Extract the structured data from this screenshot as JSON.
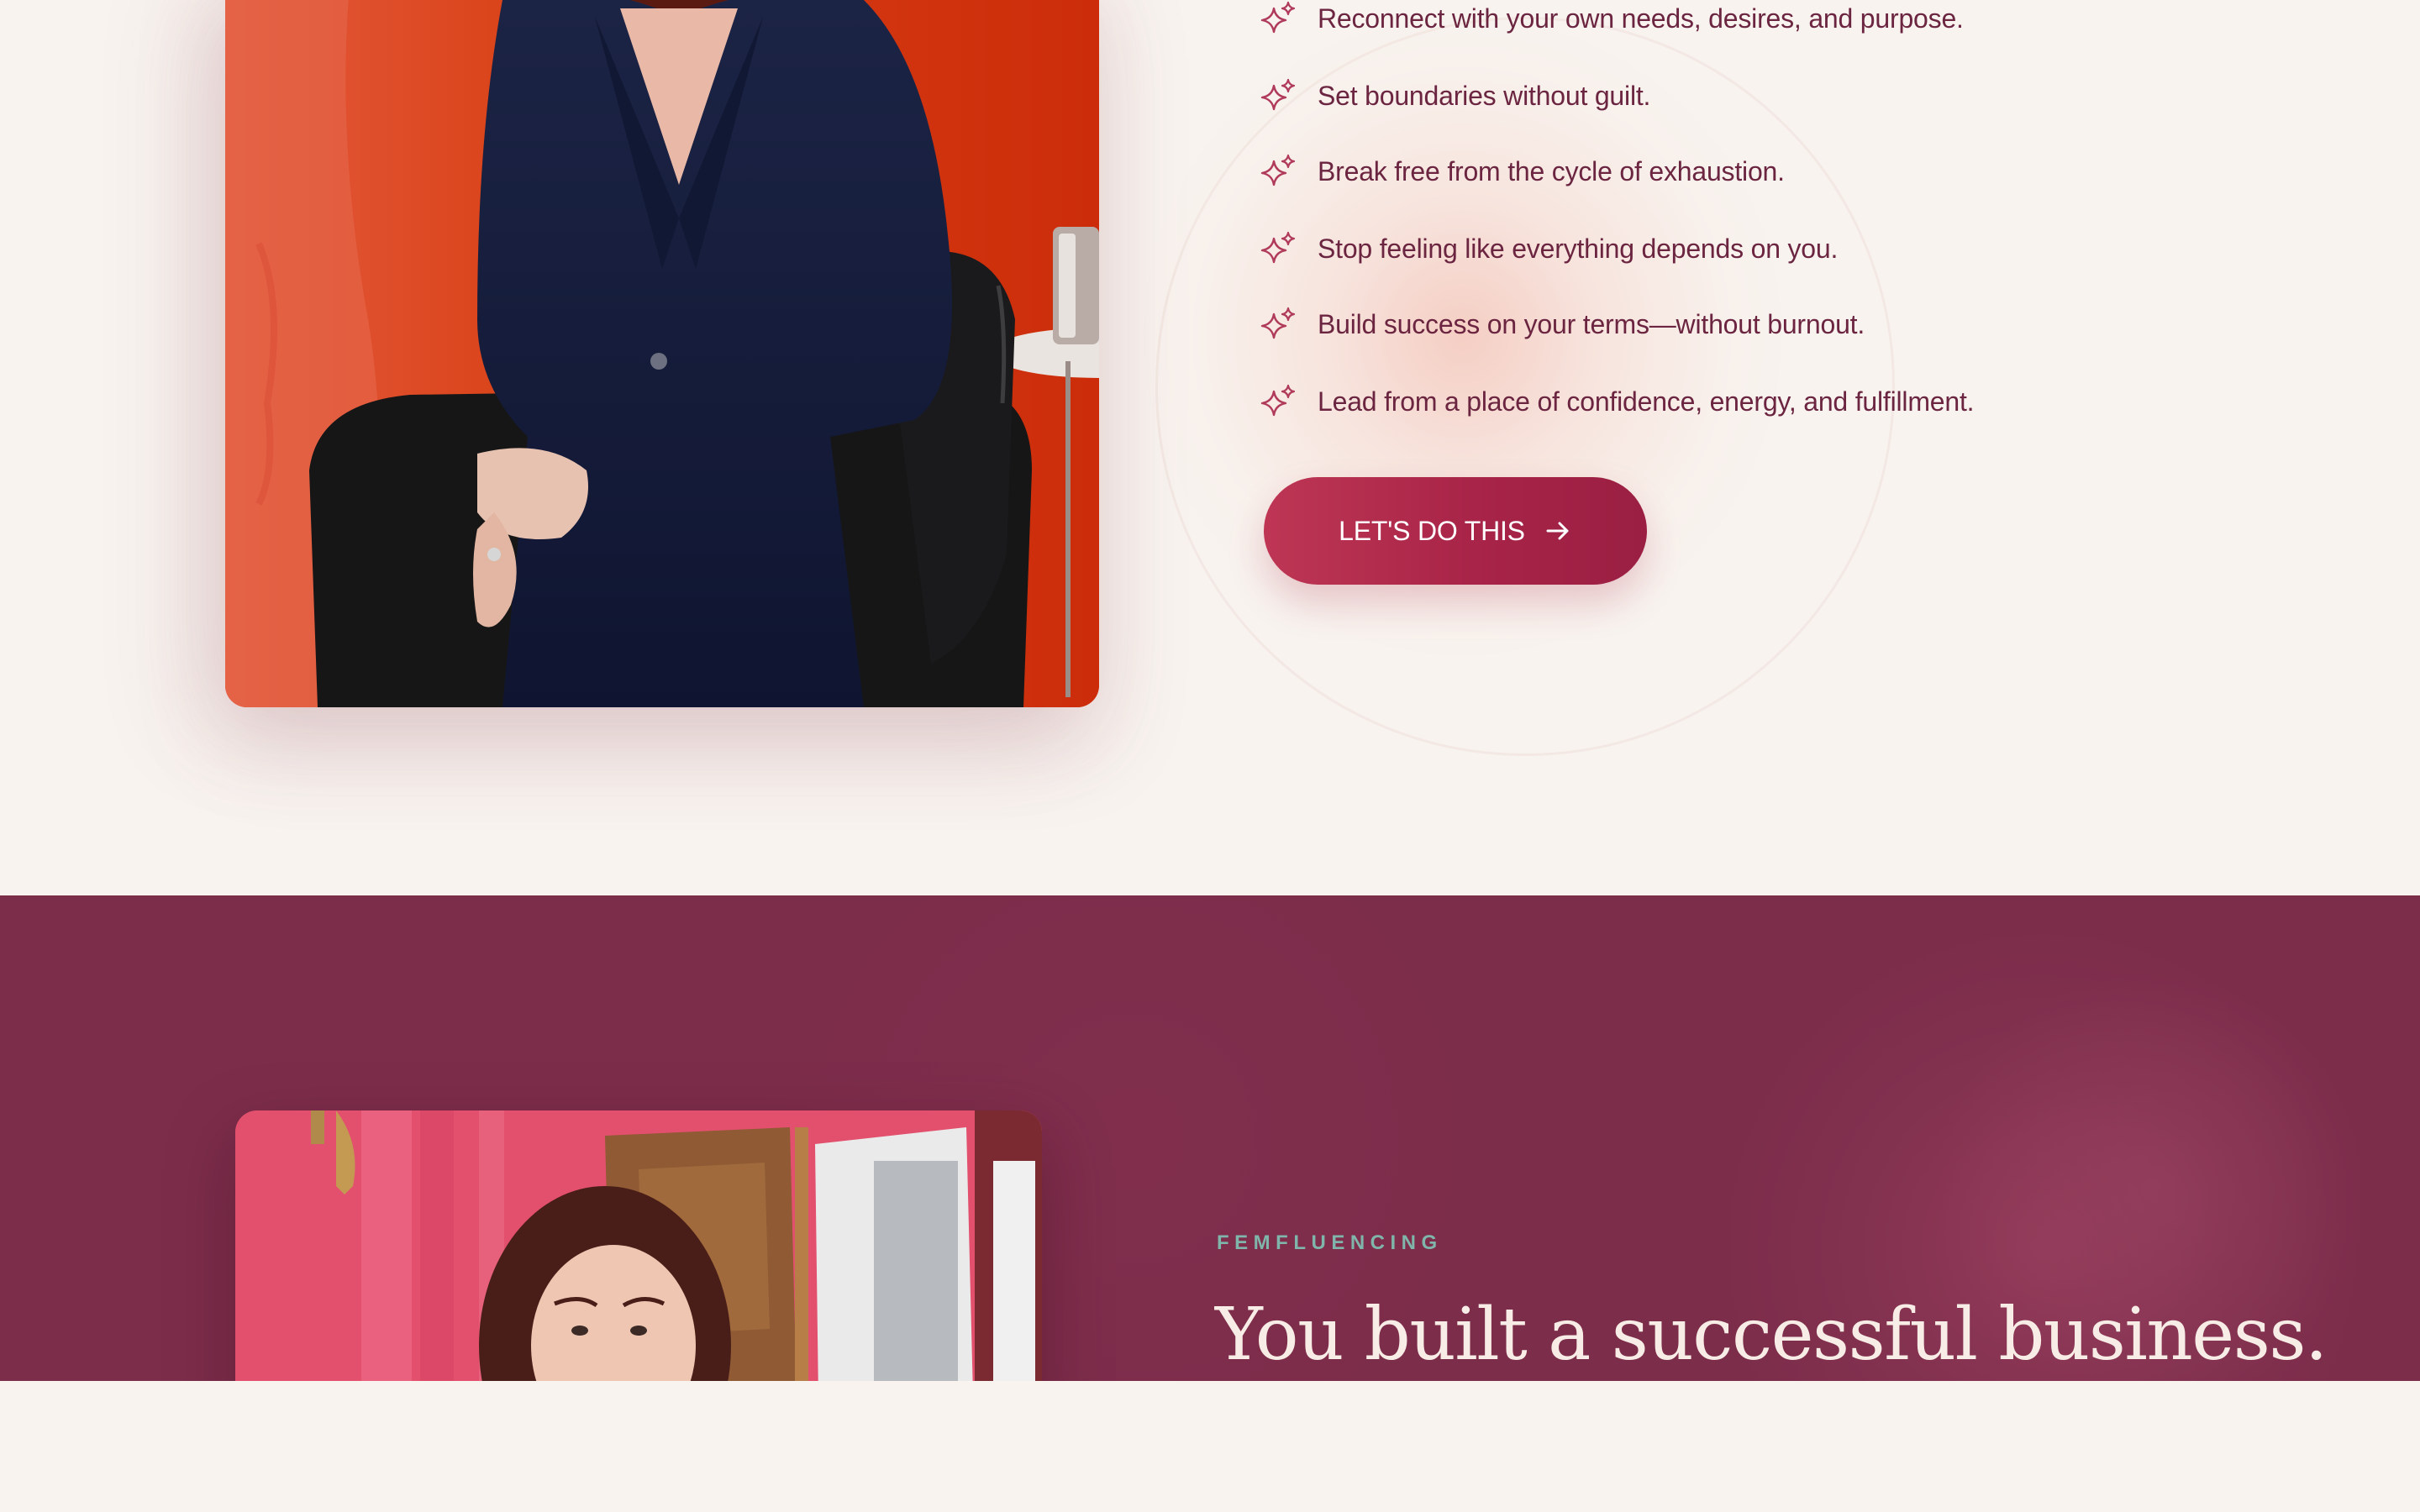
{
  "colors": {
    "page_background": "#f8f3ef",
    "accent_text": "#6b2540",
    "cta_gradient_start": "#be3654",
    "cta_gradient_end": "#9a1f42",
    "section_background": "#7c2d4a",
    "eyebrow_color": "#7fb5aa",
    "headline_color": "#f8ece6"
  },
  "benefits": {
    "icon": "sparkle-icon",
    "items": [
      {
        "text": "Reconnect with your own needs, desires, and purpose."
      },
      {
        "text": "Set boundaries without guilt."
      },
      {
        "text": "Break free from the cycle of exhaustion."
      },
      {
        "text": "Stop feeling like everything depends on you."
      },
      {
        "text": "Build success on your terms—without burnout."
      },
      {
        "text": "Lead from a place of confidence, energy, and fulfillment."
      }
    ]
  },
  "cta": {
    "label": "LET'S DO THIS",
    "icon": "arrow-right-icon"
  },
  "about": {
    "eyebrow": "FEMFLUENCING",
    "headline": "You built a successful business."
  }
}
